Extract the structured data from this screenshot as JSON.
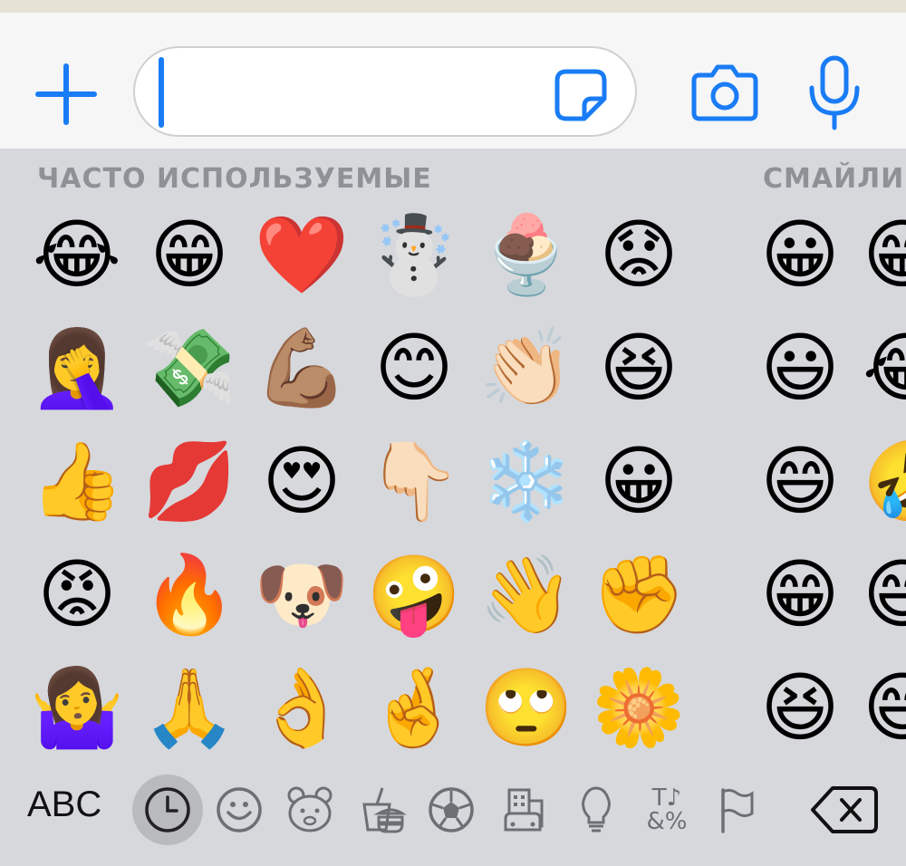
{
  "input": {
    "text": "",
    "icons": {
      "plus": "plus-icon",
      "sticker": "sticker-icon",
      "camera": "camera-icon",
      "microphone": "microphone-icon"
    },
    "accent_color": "#1a7cf5"
  },
  "emoji_keyboard": {
    "sections": [
      {
        "title": "ЧАСТО ИСПОЛЬЗУЕМЫЕ"
      },
      {
        "title": "СМАЙЛИ"
      }
    ],
    "frequent": [
      [
        "😂",
        "😁",
        "❤️",
        "☃️",
        "🍨",
        "😟"
      ],
      [
        "🤦‍♀️",
        "💸",
        "💪🏽",
        "😊",
        "👏🏻",
        "😆"
      ],
      [
        "👍",
        "💋",
        "😍",
        "👇🏻",
        "❄️",
        "😀"
      ],
      [
        "😡",
        "🔥",
        "🐶",
        "🤪",
        "👋",
        "✊"
      ],
      [
        "🤷‍♀️",
        "🙏",
        "👌",
        "🤞",
        "🙄",
        "🌼"
      ]
    ],
    "smileys_visible": [
      "😀",
      "😃",
      "😄",
      "😁",
      "😆"
    ],
    "smileys_partial": [
      "😁",
      "😂",
      "🤣",
      "😅",
      "😄"
    ],
    "bottom_bar": {
      "abc_label": "ABC",
      "categories": [
        "recent-clock-icon",
        "smiley-icon",
        "animal-icon",
        "food-icon",
        "ball-icon",
        "building-icon",
        "bulb-icon",
        "symbols-icon",
        "flag-icon"
      ],
      "symbols_glyph_top": "T♪",
      "symbols_glyph_bottom": "&%",
      "backspace": "backspace-icon"
    }
  }
}
